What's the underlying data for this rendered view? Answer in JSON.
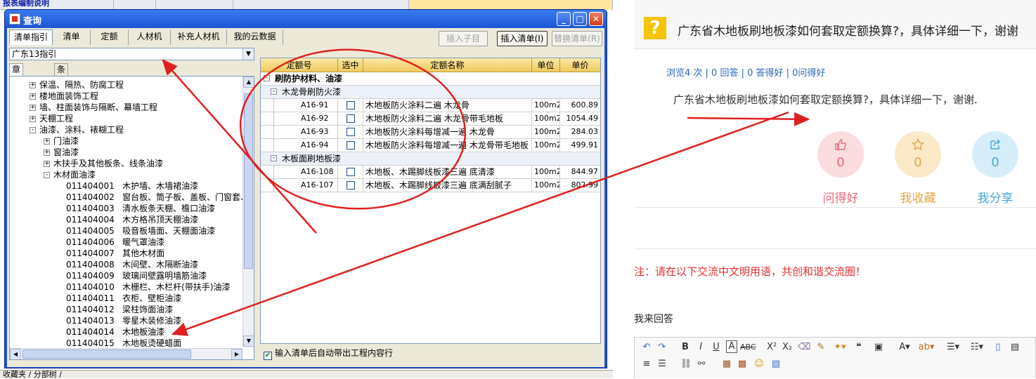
{
  "background": {
    "title_fragment": "报表编制说明",
    "bottom_tab": "收藏夹 / 分部树 /"
  },
  "dialog": {
    "title": "查询",
    "tabs": [
      "清单指引",
      "清单",
      "定额",
      "人材机",
      "补充人材机",
      "我的云数据"
    ],
    "selected_tab": "清单指引",
    "buttons": {
      "insert_child": "插入子目",
      "insert_list": "插入清单(I)",
      "replace_list": "替换清单(R)"
    },
    "combo_value": "广东13指引",
    "left_tabs": [
      "章节查询",
      "条件查询"
    ],
    "tree": [
      {
        "level": 1,
        "toggle": "+",
        "label": "保温、隔热、防腐工程"
      },
      {
        "level": 1,
        "toggle": "+",
        "label": "楼地面装饰工程"
      },
      {
        "level": 1,
        "toggle": "+",
        "label": "墙、柱面装饰与隔断、幕墙工程"
      },
      {
        "level": 1,
        "toggle": "+",
        "label": "天棚工程"
      },
      {
        "level": 1,
        "toggle": "-",
        "label": "油漆、涂料、裱糊工程"
      },
      {
        "level": 2,
        "toggle": "+",
        "label": "门油漆"
      },
      {
        "level": 2,
        "toggle": "+",
        "label": "窗油漆"
      },
      {
        "level": 2,
        "toggle": "+",
        "label": "木扶手及其他板条、线条油漆"
      },
      {
        "level": 2,
        "toggle": "-",
        "label": "木材面油漆"
      },
      {
        "level": 3,
        "toggle": "",
        "label": "011404001   木护墙、木墙裙油漆"
      },
      {
        "level": 3,
        "toggle": "",
        "label": "011404002   窗台板、筒子板、盖板、门窗套、"
      },
      {
        "level": 3,
        "toggle": "",
        "label": "011404003   清水板条天棚、檐口油漆"
      },
      {
        "level": 3,
        "toggle": "",
        "label": "011404004   木方格吊顶天棚油漆"
      },
      {
        "level": 3,
        "toggle": "",
        "label": "011404005   吸音板墙面、天棚面油漆"
      },
      {
        "level": 3,
        "toggle": "",
        "label": "011404006   暖气罩油漆"
      },
      {
        "level": 3,
        "toggle": "",
        "label": "011404007   其他木材面"
      },
      {
        "level": 3,
        "toggle": "",
        "label": "011404008   木间壁、木隔断油漆"
      },
      {
        "level": 3,
        "toggle": "",
        "label": "011404009   玻璃间壁露明墙筋油漆"
      },
      {
        "level": 3,
        "toggle": "",
        "label": "011404010   木栅栏、木栏杆(带扶手)油漆"
      },
      {
        "level": 3,
        "toggle": "",
        "label": "011404011   衣柜、壁柜油漆"
      },
      {
        "level": 3,
        "toggle": "",
        "label": "011404012   梁柱饰面油漆"
      },
      {
        "level": 3,
        "toggle": "",
        "label": "011404013   零星木装修油漆"
      },
      {
        "level": 3,
        "toggle": "",
        "label": "011404014   木地板油漆",
        "selected": true
      },
      {
        "level": 3,
        "toggle": "",
        "label": "011404015   木地板烫硬蜡面"
      }
    ],
    "grid": {
      "headers": [
        "定额号",
        "选中",
        "定额名称",
        "单位",
        "单价"
      ],
      "top_group": "刷防护材料、油漆",
      "groups": [
        {
          "name": "木龙骨刷防火漆",
          "rows": [
            {
              "code": "A16-91",
              "name": "木地板防火涂料二遍 木龙骨",
              "unit": "100m2",
              "price": "600.89"
            },
            {
              "code": "A16-92",
              "name": "木地板防火涂料二遍 木龙骨带毛地板",
              "unit": "100m2",
              "price": "1054.49"
            },
            {
              "code": "A16-93",
              "name": "木地板防火涂料每增减一遍 木龙骨",
              "unit": "100m2",
              "price": "284.03"
            },
            {
              "code": "A16-94",
              "name": "木地板防火涂料每增减一遍 木龙骨带毛地板",
              "unit": "100m2",
              "price": "499.91"
            }
          ]
        },
        {
          "name": "木板面刷地板漆",
          "rows": [
            {
              "code": "A16-108",
              "name": "木地板、木踢脚线板漆三遍 底清漆",
              "unit": "100m2",
              "price": "844.97"
            },
            {
              "code": "A16-107",
              "name": "木地板、木踢脚线板漆三遍 底满刮腻子",
              "unit": "100m2",
              "price": "802.99"
            }
          ]
        }
      ]
    },
    "auto_option": "输入清单后自动带出工程内容行"
  },
  "right": {
    "question_icon": "?",
    "title": "广东省木地板刷地板漆如何套取定额换算?，具体详细一下，谢谢",
    "stats": "浏览4 次 | 0 回答 | 0 答得好 | 0问得好",
    "body": "广东省木地板刷地板漆如何套取定额换算?，具体详细一下，谢谢.",
    "actions": [
      {
        "label": "问得好",
        "count": "0",
        "icon": "thumbs-up-icon",
        "bg": "#fbdde0",
        "fg": "#e86a78"
      },
      {
        "label": "我收藏",
        "count": "0",
        "icon": "star-icon",
        "bg": "#fbe9c8",
        "fg": "#e0a84a"
      },
      {
        "label": "我分享",
        "count": "0",
        "icon": "share-icon",
        "bg": "#d6eefa",
        "fg": "#4aa6d8"
      }
    ],
    "note": "注：请在以下交流中文明用语，共创和谐交流圈！",
    "answer_label": "我来回答"
  },
  "annotation_color": "#e02020"
}
